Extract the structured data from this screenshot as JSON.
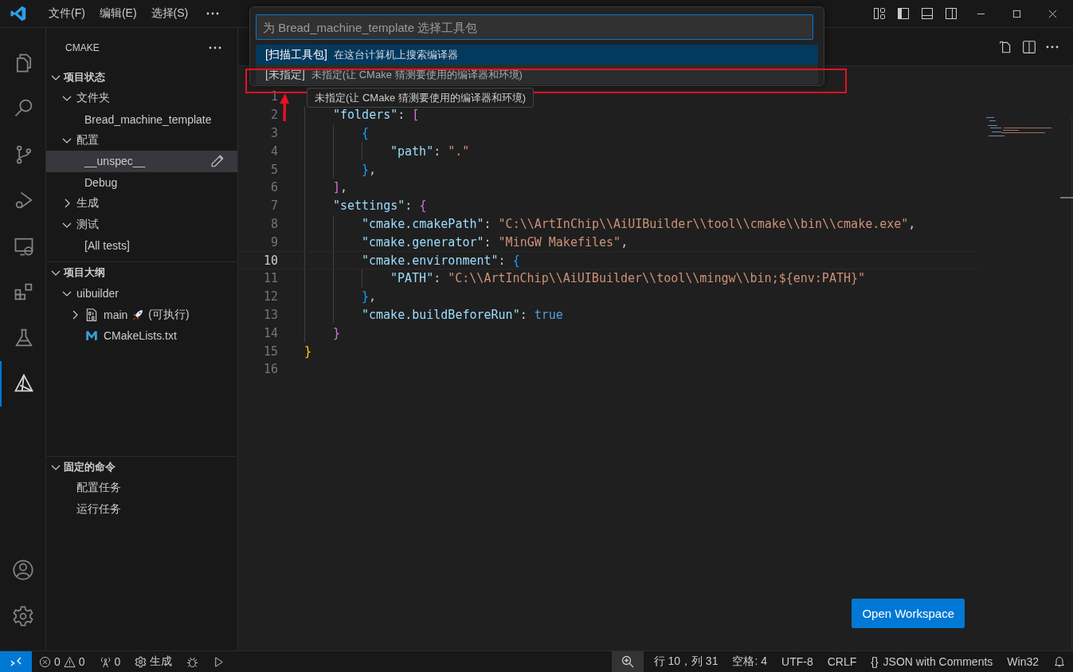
{
  "title_bar": {
    "menu": [
      "文件(F)",
      "编辑(E)",
      "选择(S)"
    ]
  },
  "activity_bar": {
    "items": [
      {
        "kind": "files",
        "selected": false
      },
      {
        "kind": "search",
        "selected": false
      },
      {
        "kind": "git",
        "selected": false
      },
      {
        "kind": "debug",
        "selected": false
      },
      {
        "kind": "remote",
        "selected": false
      },
      {
        "kind": "extensions",
        "selected": false
      },
      {
        "kind": "testing",
        "selected": false
      },
      {
        "kind": "cmake",
        "selected": true
      }
    ]
  },
  "sidebar": {
    "title": "CMAKE",
    "sections": [
      {
        "title": "项目状态",
        "expanded": true,
        "items": [
          {
            "label": "文件夹",
            "expanded": true,
            "selected": false,
            "children": [
              {
                "label": "Bread_machine_template",
                "selected": false
              }
            ]
          },
          {
            "label": "配置",
            "expanded": true,
            "selected": false,
            "children": [
              {
                "label": "__unspec__",
                "selected": true
              },
              {
                "label": "Debug",
                "selected": false
              }
            ]
          },
          {
            "label": "生成",
            "expanded": false,
            "selected": false
          },
          {
            "label": "测试",
            "expanded": true,
            "selected": false,
            "children": [
              {
                "label": "[All tests]",
                "selected": false
              }
            ]
          }
        ]
      },
      {
        "title": "项目大纲",
        "expanded": true,
        "items": [
          {
            "label": "uibuilder",
            "expanded": true,
            "selected": false,
            "children": [
              {
                "label": "main",
                "kind": "executable",
                "suffix": "(可执行)",
                "expanded": false,
                "selected": false
              },
              {
                "label": "CMakeLists.txt",
                "kind": "cmake",
                "selected": false
              }
            ]
          }
        ]
      },
      {
        "title": "固定的命令",
        "expanded": true,
        "items": [
          {
            "label": "配置任务",
            "selected": false
          },
          {
            "label": "运行任务",
            "selected": false
          }
        ]
      }
    ]
  },
  "editor": {
    "lines": [
      {
        "number": "1",
        "current": false
      },
      {
        "number": "2",
        "current": false,
        "tokens": [
          {
            "kind": "key",
            "text": "    \"folders\""
          },
          {
            "kind": "punct",
            "text": ": "
          },
          {
            "kind": "b2",
            "text": "["
          }
        ]
      },
      {
        "number": "3",
        "current": false,
        "tokens": [
          {
            "kind": "b3",
            "text": "        {"
          }
        ]
      },
      {
        "number": "4",
        "current": false,
        "tokens": [
          {
            "kind": "key",
            "text": "            \"path\""
          },
          {
            "kind": "punct",
            "text": ": "
          },
          {
            "kind": "str",
            "text": "\".\""
          }
        ]
      },
      {
        "number": "5",
        "current": false,
        "tokens": [
          {
            "kind": "b3",
            "text": "        }"
          },
          {
            "kind": "punct",
            "text": ","
          }
        ]
      },
      {
        "number": "6",
        "current": false,
        "tokens": [
          {
            "kind": "b2",
            "text": "    ]"
          },
          {
            "kind": "punct",
            "text": ","
          }
        ]
      },
      {
        "number": "7",
        "current": false,
        "tokens": [
          {
            "kind": "key",
            "text": "    \"settings\""
          },
          {
            "kind": "punct",
            "text": ": "
          },
          {
            "kind": "b2",
            "text": "{"
          }
        ]
      },
      {
        "number": "8",
        "current": false,
        "tokens": [
          {
            "kind": "key",
            "text": "        \"cmake.cmakePath\""
          },
          {
            "kind": "punct",
            "text": ": "
          },
          {
            "kind": "str",
            "text": "\"C:\\\\ArtInChip\\\\AiUIBuilder\\\\tool\\\\cmake\\\\bin\\\\cmake.exe\""
          },
          {
            "kind": "punct",
            "text": ","
          }
        ]
      },
      {
        "number": "9",
        "current": false,
        "tokens": [
          {
            "kind": "key",
            "text": "        \"cmake.generator\""
          },
          {
            "kind": "punct",
            "text": ": "
          },
          {
            "kind": "str",
            "text": "\"MinGW Makefiles\""
          },
          {
            "kind": "punct",
            "text": ","
          }
        ]
      },
      {
        "number": "10",
        "current": true,
        "tokens": [
          {
            "kind": "key",
            "text": "        \"cmake.environment\""
          },
          {
            "kind": "punct",
            "text": ": "
          },
          {
            "kind": "b3",
            "text": "{"
          }
        ]
      },
      {
        "number": "11",
        "current": false,
        "tokens": [
          {
            "kind": "key",
            "text": "            \"PATH\""
          },
          {
            "kind": "punct",
            "text": ": "
          },
          {
            "kind": "str",
            "text": "\"C:\\\\ArtInChip\\\\AiUIBuilder\\\\tool\\\\mingw\\\\bin;${env:PATH}\""
          }
        ]
      },
      {
        "number": "12",
        "current": false,
        "tokens": [
          {
            "kind": "b3",
            "text": "        }"
          },
          {
            "kind": "punct",
            "text": ","
          }
        ]
      },
      {
        "number": "13",
        "current": false,
        "tokens": [
          {
            "kind": "key",
            "text": "        \"cmake.buildBeforeRun\""
          },
          {
            "kind": "punct",
            "text": ": "
          },
          {
            "kind": "bool",
            "text": "true"
          }
        ]
      },
      {
        "number": "14",
        "current": false,
        "tokens": [
          {
            "kind": "b2",
            "text": "    }"
          }
        ]
      },
      {
        "number": "15",
        "current": false,
        "tokens": [
          {
            "kind": "b1",
            "text": "}"
          }
        ]
      },
      {
        "number": "16",
        "current": false
      }
    ],
    "open_button": "Open Workspace"
  },
  "quick_pick": {
    "placeholder": "为 Bread_machine_template 选择工具包",
    "items": [
      {
        "label": "[扫描工具包]",
        "detail": "在这台计算机上搜索编译器",
        "selected": true
      },
      {
        "label": "[未指定]",
        "detail": "未指定(让 CMake 猜测要使用的编译器和环境)",
        "selected": false
      }
    ],
    "tooltip": "未指定(让 CMake 猜测要使用的编译器和环境)"
  },
  "status_bar": {
    "left": [
      {
        "kind": "remote"
      },
      {
        "kind": "problems",
        "errors": "0",
        "warnings": "0"
      },
      {
        "kind": "ports",
        "text": "0"
      },
      {
        "kind": "build",
        "text": "生成"
      },
      {
        "kind": "debug"
      },
      {
        "kind": "run"
      }
    ],
    "right": [
      {
        "kind": "zoom"
      },
      {
        "kind": "text",
        "text": "行 10，列 31"
      },
      {
        "kind": "text",
        "text": "空格: 4"
      },
      {
        "kind": "text",
        "text": "UTF-8"
      },
      {
        "kind": "text",
        "text": "CRLF"
      },
      {
        "kind": "language",
        "icon_text": "{}",
        "text": "JSON with Comments"
      },
      {
        "kind": "text",
        "text": "Win32"
      },
      {
        "kind": "bell"
      }
    ]
  }
}
